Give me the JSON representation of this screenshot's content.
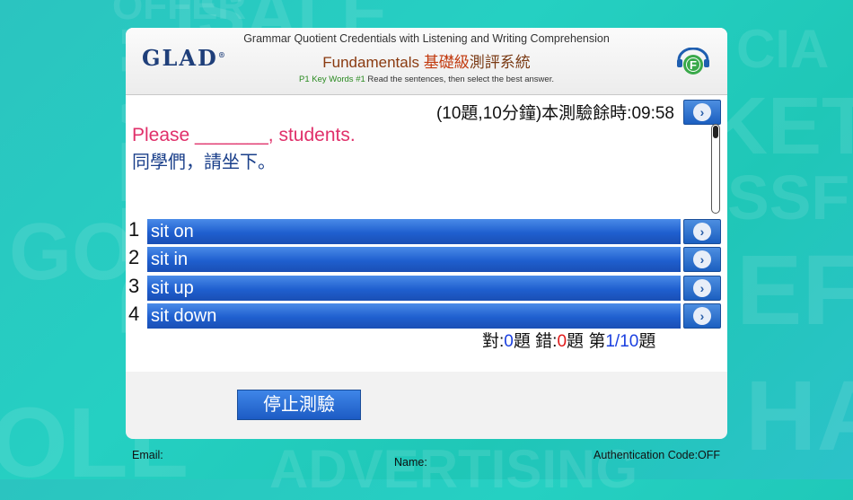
{
  "header": {
    "logo_text": "GLAD",
    "logo_mark": "®",
    "title": "Grammar Quotient Credentials with Listening and Writing Comprehension",
    "subtitle_en": "Fundamentals",
    "subtitle_cn1": "基礎級",
    "subtitle_cn2": "測評系統",
    "instruction_key": "P1 Key Words #1",
    "instruction_text": "Read the sentences, then select the best answer.",
    "badge_icon": "f-certificate-icon"
  },
  "timer": {
    "text": "(10題,10分鐘)本測驗餘時:09:58"
  },
  "question": {
    "english": "Please _______, students.",
    "chinese": "同學們，請坐下。"
  },
  "options": [
    {
      "number": "1",
      "label": "sit on"
    },
    {
      "number": "2",
      "label": "sit in"
    },
    {
      "number": "3",
      "label": "sit up"
    },
    {
      "number": "4",
      "label": "sit down"
    }
  ],
  "score": {
    "correct_label": "對:",
    "correct_value": "0",
    "correct_unit": "題",
    "wrong_label": "錯:",
    "wrong_value": "0",
    "wrong_unit": "題",
    "progress_label": "第",
    "progress_current": "1",
    "progress_sep": "/",
    "progress_total": "10",
    "progress_unit": "題"
  },
  "stop_button": {
    "label": "停止測驗"
  },
  "footer": {
    "email_label": "Email:",
    "name_label": "Name:",
    "auth_label": "Authentication Code:OFF"
  },
  "colors": {
    "background": "#25d0c2",
    "option_bar": "#1f5fcf",
    "question_en": "#e0306a",
    "question_cn": "#1a3f8a"
  }
}
